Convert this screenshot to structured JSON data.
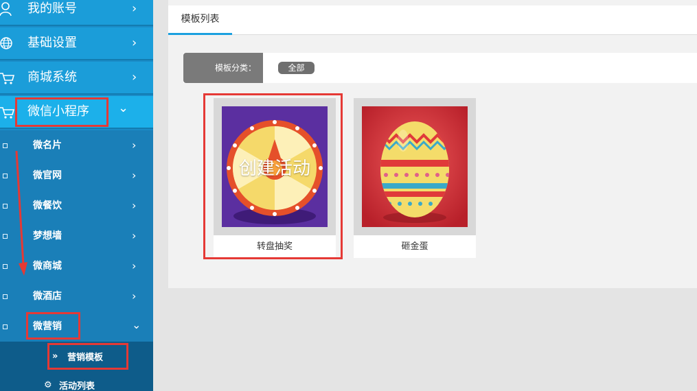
{
  "sidebar": {
    "main_items": [
      {
        "label": "我的账号",
        "icon": "user-icon",
        "chevron": "›"
      },
      {
        "label": "基础设置",
        "icon": "globe-icon",
        "chevron": "›"
      },
      {
        "label": "商城系统",
        "icon": "cart-icon",
        "chevron": "›"
      },
      {
        "label": "微信小程序",
        "icon": "cart-icon",
        "chevron": "⌄"
      }
    ],
    "sub_items": [
      {
        "label": "微名片",
        "chevron": "›"
      },
      {
        "label": "微官网",
        "chevron": "›"
      },
      {
        "label": "微餐饮",
        "chevron": "›"
      },
      {
        "label": "梦想墙",
        "chevron": "›"
      },
      {
        "label": "微商城",
        "chevron": "›"
      },
      {
        "label": "微酒店",
        "chevron": "›"
      },
      {
        "label": "微营销",
        "chevron": "⌄"
      }
    ],
    "third_items": [
      {
        "label": "营销模板",
        "icon": "double-chevron-right-icon",
        "icon_glyph": "»"
      },
      {
        "label": "活动列表",
        "icon": "gear-icon",
        "icon_glyph": "⚙"
      }
    ]
  },
  "tabs": [
    {
      "label": "模板列表",
      "active": true
    }
  ],
  "filter": {
    "label": "模板分类：",
    "chips": [
      "全部"
    ]
  },
  "templates": [
    {
      "name": "转盘抽奖",
      "overlay": "创建活动",
      "thumb": "prize-wheel"
    },
    {
      "name": "砸金蛋",
      "thumb": "golden-egg"
    }
  ],
  "colors": {
    "sidebar_bg": "#1a8cc8",
    "highlight": "#e53935",
    "tab_accent": "#1ba0df"
  }
}
